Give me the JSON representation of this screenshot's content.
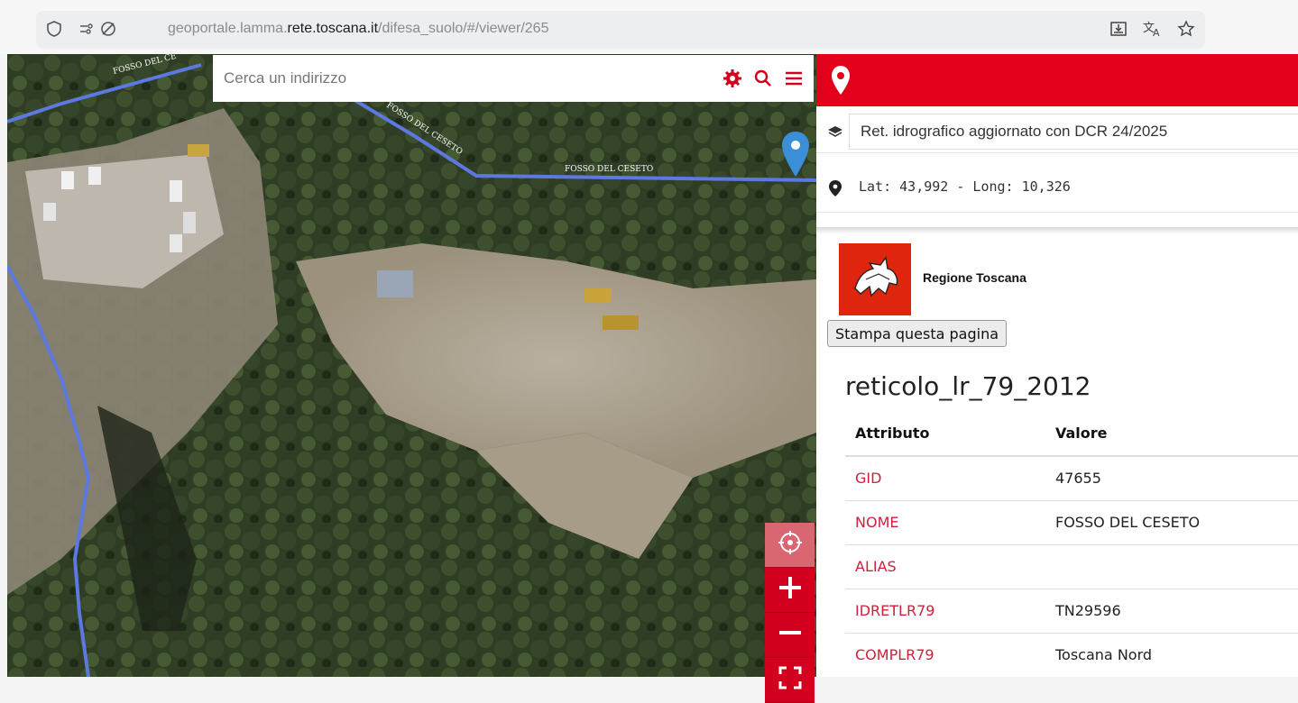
{
  "browser": {
    "url_prefix": "geoportale.lamma.",
    "url_domain": "rete.toscana.it",
    "url_path": "/difesa_suolo/#/viewer/265",
    "icons": [
      "shield-icon",
      "permissions-icon",
      "tracking-icon",
      "install-app-icon",
      "translate-icon",
      "bookmark-star-icon"
    ]
  },
  "map": {
    "search_placeholder": "Cerca un indirizzo",
    "search_icons": [
      "gear-icon",
      "search-icon",
      "menu-icon"
    ],
    "stream_labels": [
      "FOSSO DEL CE",
      "FOSSO DEL CESETO",
      "FOSSO DEL CESETO"
    ],
    "controls": [
      "locate-icon",
      "zoom-in-icon",
      "zoom-out-icon",
      "fullscreen-icon"
    ],
    "accent_color": "#e2001a",
    "stream_color": "#5b79e0"
  },
  "panel": {
    "header_icon": "map-pin-icon",
    "layer_name": "Ret. idrografico aggiornato con DCR 24/2025",
    "coords": "Lat: 43,992 - Long: 10,326",
    "logo_label": "Regione Toscana",
    "print_label": "Stampa questa pagina",
    "feature_title": "reticolo_lr_79_2012",
    "table": {
      "headers": [
        "Attributo",
        "Valore"
      ],
      "rows": [
        {
          "key": "GID",
          "value": "47655"
        },
        {
          "key": "NOME",
          "value": "FOSSO DEL CESETO"
        },
        {
          "key": "ALIAS",
          "value": ""
        },
        {
          "key": "IDRETLR79",
          "value": "TN29596"
        },
        {
          "key": "COMPLR79",
          "value": "Toscana Nord"
        }
      ]
    }
  }
}
